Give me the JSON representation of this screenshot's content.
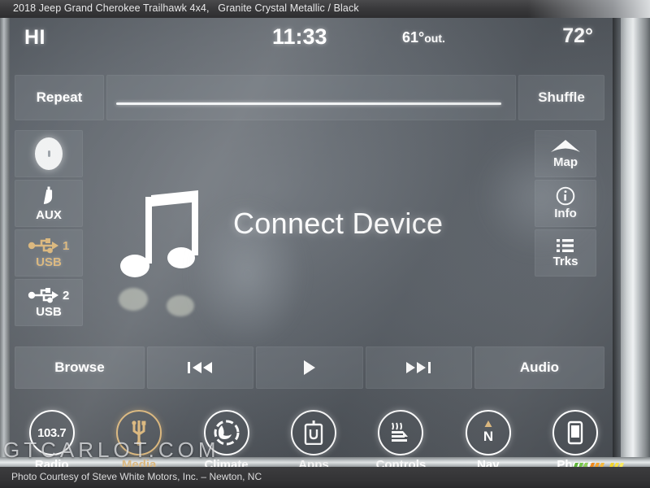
{
  "photo_caption_top": {
    "vehicle": "2018 Jeep Grand Cherokee Trailhawk 4x4,",
    "colors": "Granite Crystal Metallic / Black"
  },
  "photo_caption_bottom": {
    "credit": "Photo Courtesy of Steve White Motors, Inc. – Newton, NC"
  },
  "watermark": {
    "text": "GTCARLOT.COM"
  },
  "colors": {
    "accent_amber": "#d9b478",
    "text_white": "#ffffff",
    "screen_bg": "#5d636a",
    "tile_bg": "rgba(118,124,131,.45)",
    "stripe_green": "#5fb53a",
    "stripe_orange": "#f08a1e",
    "stripe_yellow": "#f2d32b"
  },
  "status_bar": {
    "fan_or_temp_left": "HI",
    "clock": "11:33",
    "outside_temp": "61°",
    "outside_label": "out.",
    "cabin_temp": "72°"
  },
  "playback_row": {
    "repeat_label": "Repeat",
    "shuffle_label": "Shuffle",
    "progress_percent": 100
  },
  "sources": [
    {
      "label": "",
      "icon": "disc-icon",
      "active": false
    },
    {
      "label": "AUX",
      "icon": "aux-plug-icon",
      "active": false
    },
    {
      "label": "USB",
      "badge": "1",
      "icon": "usb-icon",
      "active": true
    },
    {
      "label": "USB",
      "badge": "2",
      "icon": "usb-icon",
      "active": false
    }
  ],
  "quick_buttons": [
    {
      "label": "Map",
      "icon": "map-arrow-icon"
    },
    {
      "label": "Info",
      "icon": "info-circle-icon"
    },
    {
      "label": "Trks",
      "icon": "list-icon"
    }
  ],
  "main": {
    "message": "Connect Device",
    "icon": "music-note-icon"
  },
  "transport": {
    "browse_label": "Browse",
    "previous_icon": "previous-track-icon",
    "play_icon": "play-icon",
    "next_icon": "next-track-icon",
    "audio_label": "Audio"
  },
  "bottom_nav": [
    {
      "label": "Radio",
      "icon": "radio-frequency-icon",
      "value": "103.7",
      "active": false
    },
    {
      "label": "Media",
      "icon": "usb-media-icon",
      "active": true
    },
    {
      "label": "Climate",
      "icon": "climate-seat-fan-icon",
      "active": false
    },
    {
      "label": "Apps",
      "icon": "uconnect-apps-icon",
      "active": false
    },
    {
      "label": "Controls",
      "icon": "heated-seat-icon",
      "active": false
    },
    {
      "label": "Nav",
      "icon": "compass-north-icon",
      "active": false
    },
    {
      "label": "Phone",
      "icon": "phone-icon",
      "active": false
    }
  ]
}
